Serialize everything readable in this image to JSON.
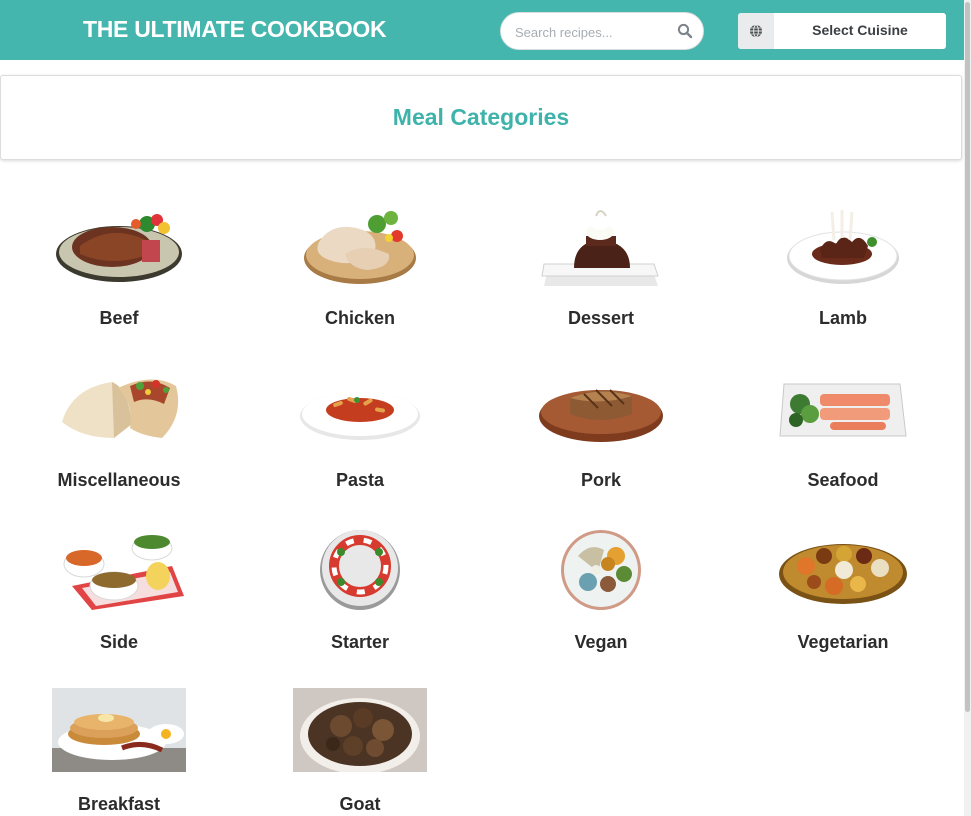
{
  "header": {
    "brand": "THE ULTIMATE COOKBOOK",
    "search_placeholder": "Search recipes...",
    "search_icon": "search-icon",
    "cuisine_icon": "globe-icon",
    "cuisine_label": "Select Cuisine",
    "bar_color": "#45b6ad"
  },
  "section": {
    "title": "Meal Categories",
    "title_color": "#3fb3aa"
  },
  "categories": [
    {
      "label": "Beef"
    },
    {
      "label": "Chicken"
    },
    {
      "label": "Dessert"
    },
    {
      "label": "Lamb"
    },
    {
      "label": "Miscellaneous"
    },
    {
      "label": "Pasta"
    },
    {
      "label": "Pork"
    },
    {
      "label": "Seafood"
    },
    {
      "label": "Side"
    },
    {
      "label": "Starter"
    },
    {
      "label": "Vegan"
    },
    {
      "label": "Vegetarian"
    },
    {
      "label": "Breakfast"
    },
    {
      "label": "Goat"
    }
  ]
}
